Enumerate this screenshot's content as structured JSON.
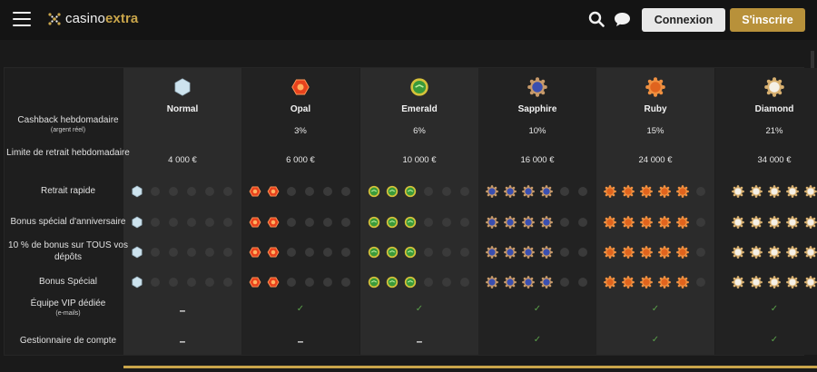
{
  "header": {
    "logo_casino": "casino",
    "logo_extra": "extra",
    "login_label": "Connexion",
    "signup_label": "S'inscrire",
    "accent": "#c9a54a"
  },
  "rows": [
    {
      "label": "Cashback hebdomadaire",
      "sub": "(argent réel)"
    },
    {
      "label": "Limite de retrait hebdomadaire",
      "sub": ""
    },
    {
      "label": "Retrait rapide",
      "sub": ""
    },
    {
      "label": "Bonus spécial d'anniversaire",
      "sub": ""
    },
    {
      "label": "10 % de bonus sur TOUS vos dépôts",
      "sub": ""
    },
    {
      "label": "Bonus Spécial",
      "sub": ""
    },
    {
      "label": "Équipe VIP dédiée",
      "sub": "(e-mails)"
    },
    {
      "label": "Gestionnaire de compte",
      "sub": ""
    }
  ],
  "tiers": [
    {
      "name": "Normal",
      "gem": "normal-gem-icon",
      "cashback": "",
      "limit": "4 000 €",
      "levels": [
        1,
        1,
        1,
        1
      ],
      "vip": "–",
      "manager": "–"
    },
    {
      "name": "Opal",
      "gem": "opal-gem-icon",
      "cashback": "3%",
      "limit": "6 000 €",
      "levels": [
        2,
        2,
        2,
        2
      ],
      "vip": "✓",
      "manager": "–"
    },
    {
      "name": "Emerald",
      "gem": "emerald-gem-icon",
      "cashback": "6%",
      "limit": "10 000 €",
      "levels": [
        3,
        3,
        3,
        3
      ],
      "vip": "✓",
      "manager": "–"
    },
    {
      "name": "Sapphire",
      "gem": "sapphire-gem-icon",
      "cashback": "10%",
      "limit": "16 000 €",
      "levels": [
        4,
        4,
        4,
        4
      ],
      "vip": "✓",
      "manager": "✓"
    },
    {
      "name": "Ruby",
      "gem": "ruby-gem-icon",
      "cashback": "15%",
      "limit": "24 000 €",
      "levels": [
        5,
        5,
        5,
        5
      ],
      "vip": "✓",
      "manager": "✓"
    },
    {
      "name": "Diamond",
      "gem": "diamond-gem-icon",
      "cashback": "21%",
      "limit": "34 000 €",
      "levels": [
        5,
        5,
        5,
        5
      ],
      "vip": "✓",
      "manager": "✓"
    }
  ],
  "gem_colors": {
    "normal": "#cde3ee",
    "opal": "#e8421c",
    "emerald": "#3a9a3a",
    "sapphire": "#3a4fb0",
    "ruby": "#e0641e",
    "diamond": "#e6c89a"
  }
}
